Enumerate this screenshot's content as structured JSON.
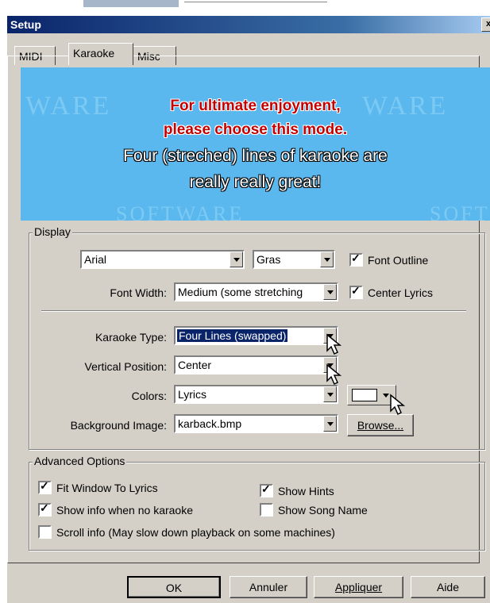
{
  "window": {
    "title": "Setup",
    "close_glyph": "x"
  },
  "tabs": [
    {
      "label": "MIDI"
    },
    {
      "label": "Karaoke"
    },
    {
      "label": "Misc"
    }
  ],
  "banner": {
    "line1": "For ultimate enjoyment,",
    "line2": "please choose this mode.",
    "line3": "Four (streched) lines of karaoke are",
    "line4": "really really great!",
    "watermarks": [
      "WARE",
      "WARE",
      "SOFTWARE",
      "SOFT"
    ],
    "bg_color": "#5ab8ee"
  },
  "display": {
    "group_label": "Display",
    "font_value": "Arial",
    "style_value": "Gras",
    "font_outline_label": "Font Outline",
    "font_outline_checked": true,
    "font_width_label": "Font Width:",
    "font_width_value": "Medium (some stretching",
    "center_lyrics_label": "Center Lyrics",
    "center_lyrics_checked": true,
    "karaoke_type_label": "Karaoke Type:",
    "karaoke_type_value": "Four Lines (swapped)",
    "vertical_position_label": "Vertical Position:",
    "vertical_position_value": "Center",
    "colors_label": "Colors:",
    "colors_value": "Lyrics",
    "background_image_label": "Background Image:",
    "background_image_value": "karback.bmp",
    "browse_label": "Browse..."
  },
  "advanced": {
    "group_label": "Advanced Options",
    "fit_window_label": "Fit Window To Lyrics",
    "fit_window_checked": true,
    "show_hints_label": "Show Hints",
    "show_hints_checked": true,
    "show_info_label": "Show info when no karaoke",
    "show_info_checked": true,
    "show_song_name_label": "Show Song Name",
    "show_song_name_checked": false,
    "scroll_info_label": "Scroll info (May slow down playback on some machines)",
    "scroll_info_checked": false
  },
  "buttons": {
    "ok": "OK",
    "cancel": "Annuler",
    "apply": "Appliquer",
    "help": "Aide"
  },
  "colors": {
    "title_bar": "#0a246a",
    "dialog_bg": "#d4d0c8",
    "selection": "#0a246a",
    "banner_red": "#c40000"
  }
}
